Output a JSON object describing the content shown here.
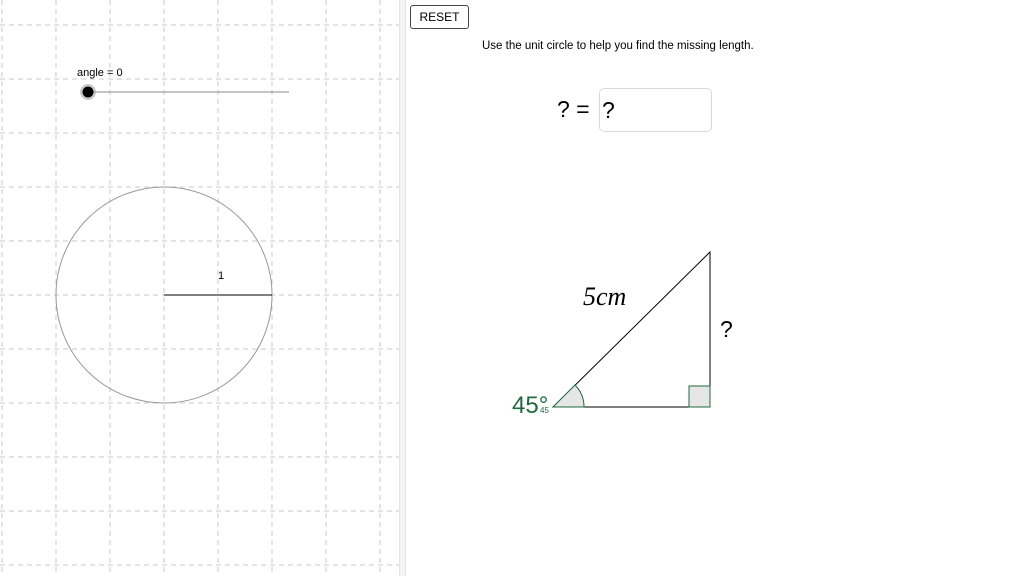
{
  "toolbar": {
    "reset_label": "RESET"
  },
  "instruction": "Use the unit circle to help you find the missing length.",
  "answer": {
    "label": "? =",
    "value": "?"
  },
  "slider": {
    "label": "angle = 0",
    "value": 0
  },
  "unit_circle": {
    "radius_label": "1"
  },
  "triangle": {
    "hypotenuse_label": "5cm",
    "opposite_label": "?",
    "angle_label": "45°",
    "angle_small_label": "45"
  },
  "colors": {
    "angle_green": "#1e6b3e",
    "grid_dash": "#c8c8c8",
    "circle_stroke": "#999999",
    "shade_fill": "#e6e6e6"
  }
}
